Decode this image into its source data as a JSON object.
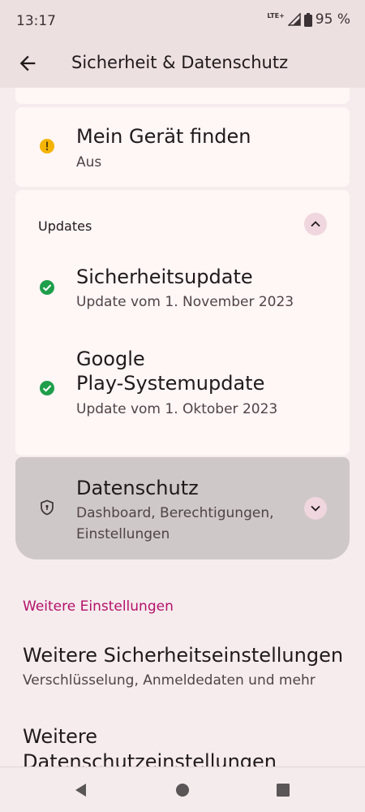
{
  "status_bar": {
    "time": "13:17",
    "network": "LTE+",
    "battery": "95 %"
  },
  "app_bar": {
    "title": "Sicherheit & Datenschutz"
  },
  "find_device": {
    "title": "Mein Gerät finden",
    "status": "Aus"
  },
  "updates": {
    "header": "Updates",
    "security": {
      "title": "Sicherheitsupdate",
      "subtitle": "Update vom 1. November 2023"
    },
    "play": {
      "title_line1": "Google",
      "title_line2": "Play-Systemupdate",
      "subtitle": "Update vom 1. Oktober 2023"
    }
  },
  "privacy": {
    "title": "Datenschutz",
    "subtitle_line1": "Dashboard, Berechtigungen,",
    "subtitle_line2": "Einstellungen"
  },
  "more": {
    "header": "Weitere Einstellungen",
    "security": {
      "title": "Weitere Sicherheitseinstellungen",
      "subtitle": "Verschlüsselung, Anmeldedaten und mehr"
    },
    "privacy": {
      "title_line1": "Weitere",
      "title_line2": "Datenschutzeinstellungen"
    }
  },
  "colors": {
    "accent": "#b3126b",
    "ok": "#1e9e4a",
    "warn": "#f4b400"
  }
}
